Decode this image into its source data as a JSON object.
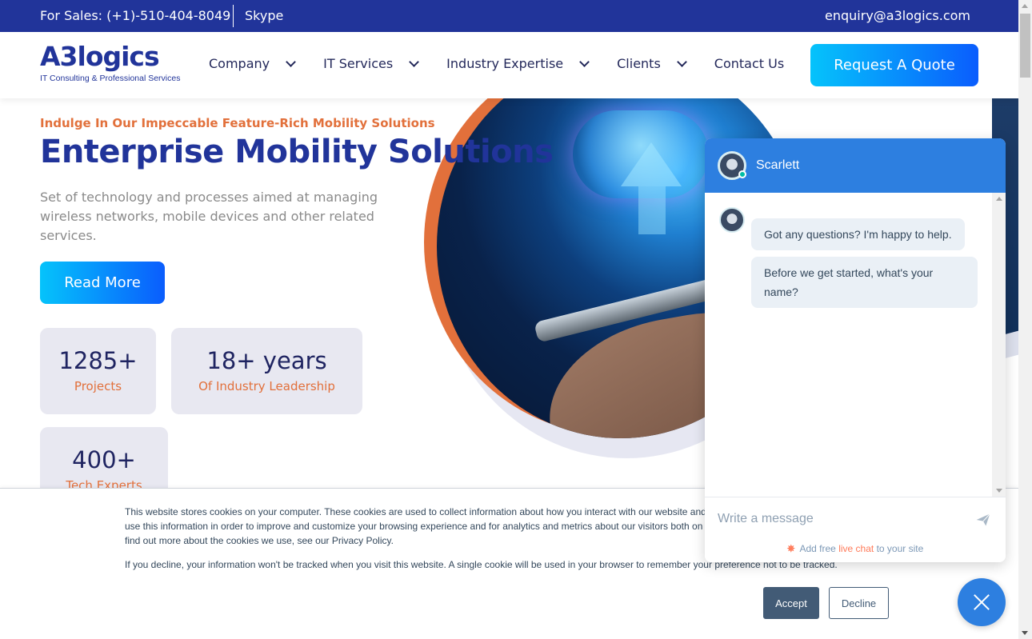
{
  "topbar": {
    "sales": "For Sales: (+1)-510-404-8049",
    "skype": "Skype",
    "email": "enquiry@a3logics.com"
  },
  "header": {
    "logo_word": "A3logics",
    "logo_tagline": "IT Consulting & Professional Services",
    "nav": [
      {
        "label": "Company",
        "dropdown": true
      },
      {
        "label": "IT Services",
        "dropdown": true
      },
      {
        "label": "Industry Expertise",
        "dropdown": true
      },
      {
        "label": "Clients",
        "dropdown": true
      },
      {
        "label": "Contact Us",
        "dropdown": false
      }
    ],
    "cta_label": "Request A Quote"
  },
  "hero": {
    "eyebrow": "Indulge In Our Impeccable Feature-Rich Mobility Solutions",
    "title": "Enterprise Mobility Solutions",
    "description": "Set of technology and processes aimed at managing wireless networks, mobile devices and other related services.",
    "read_more": "Read More",
    "stats": [
      {
        "value": "1285+",
        "label": "Projects"
      },
      {
        "value": "18+ years",
        "label": "Of Industry Leadership"
      },
      {
        "value": "400+",
        "label": "Tech Experts"
      }
    ]
  },
  "cookie": {
    "text1": "This website stores cookies on your computer. These cookies are used to collect information about how you interact with our website and allow us to remember you. We use this information in order to improve and customize your browsing experience and for analytics and metrics about our visitors both on this website and other media. To find out more about the cookies we use, see our Privacy Policy.",
    "text2": "If you decline, your information won't be tracked when you visit this website. A single cookie will be used in your browser to remember your preference not to be tracked.",
    "accept": "Accept",
    "decline": "Decline"
  },
  "chat": {
    "agent_name": "Scarlett",
    "status": "online",
    "messages": [
      "Got any questions? I'm happy to help.",
      "Before we get started, what's your name?"
    ],
    "input_placeholder": "Write a message",
    "powered_prefix": "Add free",
    "powered_link": "live chat",
    "powered_suffix": "to your site"
  },
  "colors": {
    "brand_navy": "#21349a",
    "accent_orange": "#e2703b",
    "chat_blue": "#2d7fe0",
    "cookie_button": "#425b76"
  }
}
